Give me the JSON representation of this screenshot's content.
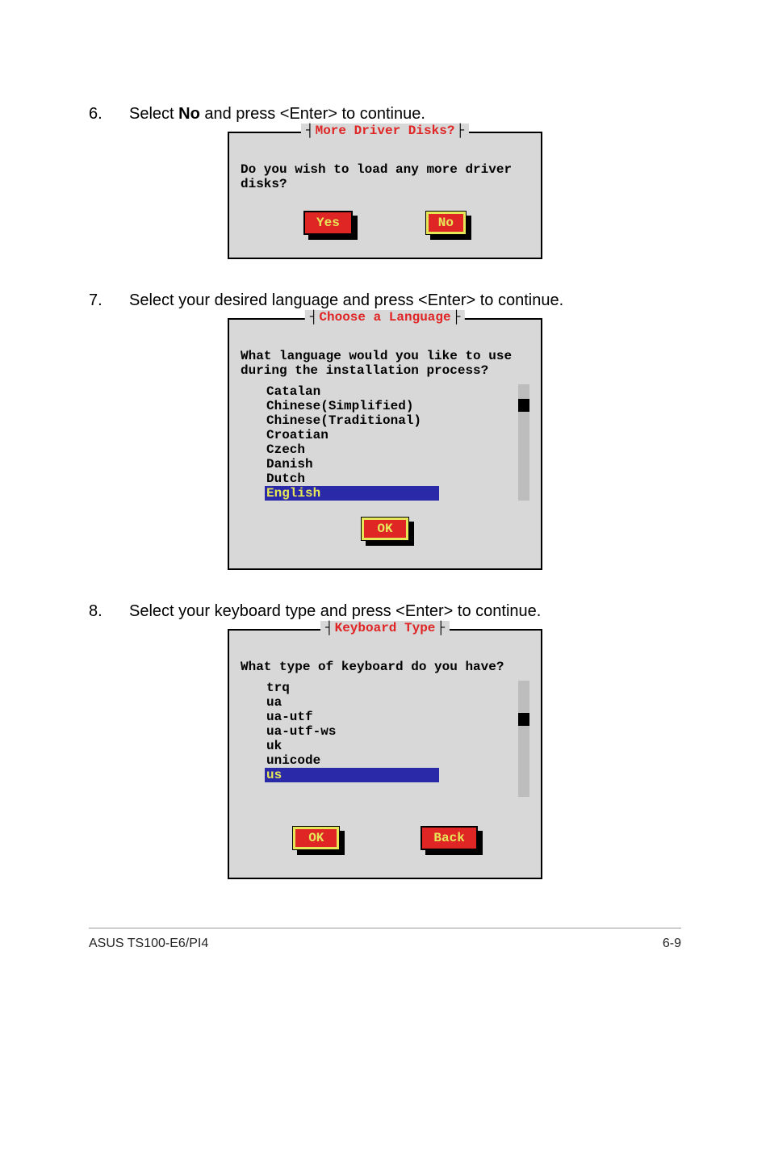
{
  "steps": {
    "s6": {
      "num": "6.",
      "before": "Select ",
      "bold": "No",
      "after": " and press <Enter> to continue."
    },
    "s7": {
      "num": "7.",
      "text": "Select your desired language and press <Enter> to continue."
    },
    "s8": {
      "num": "8.",
      "text": "Select your keyboard type and press <Enter> to continue."
    }
  },
  "dialog1": {
    "title": "More Driver Disks?",
    "body": "Do you wish to load any more driver disks?",
    "btnYes": "Yes",
    "btnNo": "No"
  },
  "dialog2": {
    "title": "Choose a Language",
    "body": "What language would you like to use during the installation process?",
    "items": [
      "Catalan",
      "Chinese(Simplified)",
      "Chinese(Traditional)",
      "Croatian",
      "Czech",
      "Danish",
      "Dutch",
      "English"
    ],
    "hash": "#",
    "btnOk": "OK"
  },
  "dialog3": {
    "title": "Keyboard Type",
    "body": "What type of keyboard do you have?",
    "items": [
      "trq",
      "ua",
      "ua-utf",
      "ua-utf-ws",
      "uk",
      "unicode",
      "us"
    ],
    "hash": "#",
    "btnOk": "OK",
    "btnBack": "Back"
  },
  "footer": {
    "left": "ASUS TS100-E6/PI4",
    "right": "6-9"
  }
}
